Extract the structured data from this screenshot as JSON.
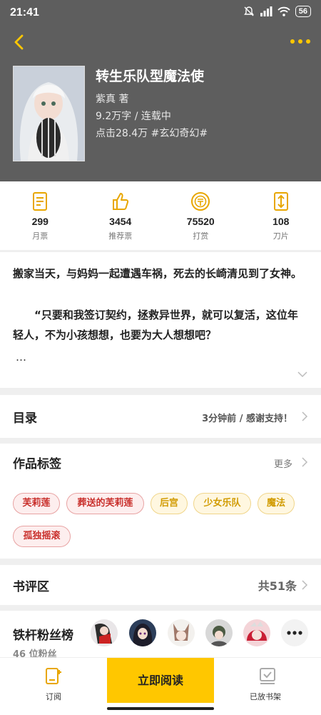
{
  "status_bar": {
    "time": "21:41",
    "battery": "56"
  },
  "book": {
    "title": "转生乐队型魔法使",
    "author": "紫真  著",
    "words_status": "9.2万字 / 连载中",
    "clicks_genre": "点击28.4万  #玄幻奇幻#"
  },
  "stats": [
    {
      "icon": "monthly-ticket-icon",
      "value": "299",
      "label": "月票"
    },
    {
      "icon": "thumbs-up-icon",
      "value": "3454",
      "label": "推荐票"
    },
    {
      "icon": "reward-coin-icon",
      "value": "75520",
      "label": "打赏"
    },
    {
      "icon": "blade-icon",
      "value": "108",
      "label": "刀片"
    }
  ],
  "description": {
    "para1": "搬家当天，与妈妈一起遭遇车祸，死去的长崎清见到了女神。",
    "para2": "　　“只要和我签订契约，拯救异世界，就可以复活，这位年轻人，不为小孩想想，也要为大人想想吧？",
    "ellipsis": "…"
  },
  "toc": {
    "title": "目录",
    "right": "3分钟前 / 感谢支持！"
  },
  "tags_section": {
    "title": "作品标签",
    "more": "更多",
    "tags": [
      {
        "label": "芙莉莲",
        "style": "red"
      },
      {
        "label": "葬送的芙莉莲",
        "style": "red"
      },
      {
        "label": "后宫",
        "style": "yellow"
      },
      {
        "label": "少女乐队",
        "style": "yellow"
      },
      {
        "label": "魔法",
        "style": "yellow"
      },
      {
        "label": "孤独摇滚",
        "style": "red"
      }
    ]
  },
  "reviews": {
    "title": "书评区",
    "count": "共51条"
  },
  "fans": {
    "title": "铁杆粉丝榜",
    "count": "46 位粉丝",
    "more_icon": "ellipsis-icon"
  },
  "bottom_bar": {
    "subscribe": "订阅",
    "read_now": "立即阅读",
    "in_shelf": "已放书架"
  },
  "colors": {
    "accent": "#ffc700",
    "header_bg": "#5e5e5e",
    "tag_red": "#c9302c",
    "tag_yellow": "#d19b00"
  }
}
